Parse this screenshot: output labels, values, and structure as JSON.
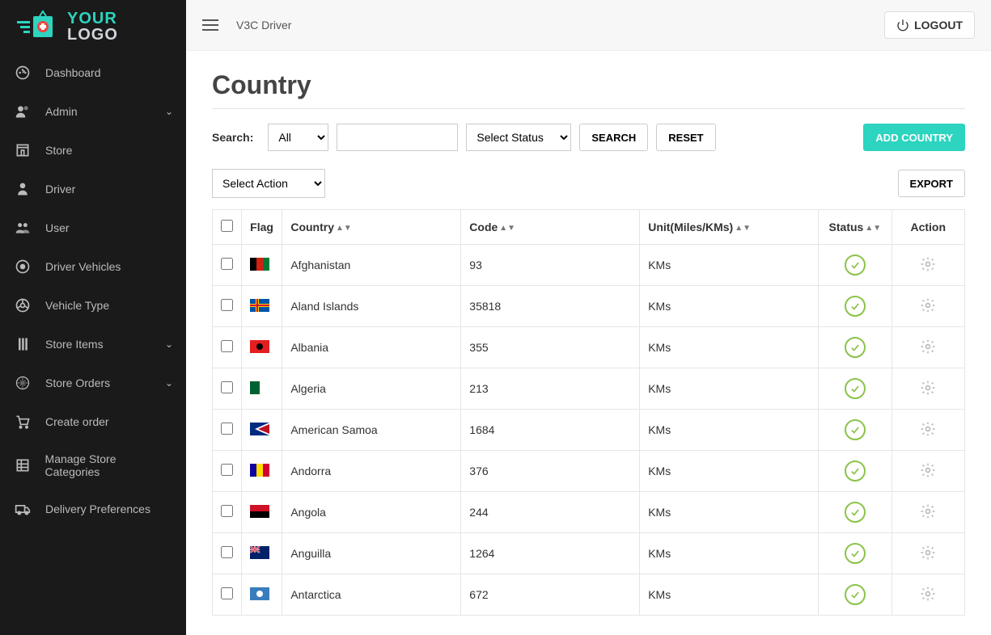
{
  "brand": {
    "top": "YOUR",
    "bottom": "LOGO"
  },
  "sidebar": {
    "items": [
      {
        "label": "Dashboard",
        "icon": "dashboard",
        "expandable": false
      },
      {
        "label": "Admin",
        "icon": "admin",
        "expandable": true
      },
      {
        "label": "Store",
        "icon": "store",
        "expandable": false
      },
      {
        "label": "Driver",
        "icon": "driver",
        "expandable": false
      },
      {
        "label": "User",
        "icon": "user",
        "expandable": false
      },
      {
        "label": "Driver Vehicles",
        "icon": "target",
        "expandable": false
      },
      {
        "label": "Vehicle Type",
        "icon": "wheel",
        "expandable": false
      },
      {
        "label": "Store Items",
        "icon": "items",
        "expandable": true
      },
      {
        "label": "Store Orders",
        "icon": "orders",
        "expandable": true
      },
      {
        "label": "Create order",
        "icon": "cart",
        "expandable": false
      },
      {
        "label": "Manage Store Categories",
        "icon": "categories",
        "expandable": false
      },
      {
        "label": "Delivery Preferences",
        "icon": "delivery",
        "expandable": false
      }
    ]
  },
  "topbar": {
    "breadcrumb": "V3C  Driver",
    "logout": "LOGOUT"
  },
  "page": {
    "title": "Country"
  },
  "search": {
    "label": "Search:",
    "filter_selected": "All",
    "status_selected": "Select Status",
    "search_btn": "SEARCH",
    "reset_btn": "RESET",
    "add_btn": "ADD COUNTRY"
  },
  "actions": {
    "select_action": "Select Action",
    "export": "EXPORT"
  },
  "table": {
    "headers": {
      "flag": "Flag",
      "country": "Country",
      "code": "Code",
      "unit": "Unit(Miles/KMs)",
      "status": "Status",
      "action": "Action"
    },
    "rows": [
      {
        "country": "Afghanistan",
        "code": "93",
        "unit": "KMs",
        "flag_colors": [
          "#000",
          "#d32011",
          "#007a36"
        ],
        "flag_style": "tricolor-v"
      },
      {
        "country": "Aland Islands",
        "code": "35818",
        "unit": "KMs",
        "flag_colors": [
          "#0053a5",
          "#ffce00",
          "#d21034"
        ],
        "flag_style": "nordic"
      },
      {
        "country": "Albania",
        "code": "355",
        "unit": "KMs",
        "flag_colors": [
          "#e41e20",
          "#000"
        ],
        "flag_style": "solid"
      },
      {
        "country": "Algeria",
        "code": "213",
        "unit": "KMs",
        "flag_colors": [
          "#006233",
          "#fff"
        ],
        "flag_style": "bicolor-v"
      },
      {
        "country": "American Samoa",
        "code": "1684",
        "unit": "KMs",
        "flag_colors": [
          "#002b7f",
          "#fff",
          "#bd1021"
        ],
        "flag_style": "diagonal"
      },
      {
        "country": "Andorra",
        "code": "376",
        "unit": "KMs",
        "flag_colors": [
          "#10069f",
          "#fedd00",
          "#d50032"
        ],
        "flag_style": "tricolor-v"
      },
      {
        "country": "Angola",
        "code": "244",
        "unit": "KMs",
        "flag_colors": [
          "#ce1126",
          "#000"
        ],
        "flag_style": "bicolor-h"
      },
      {
        "country": "Anguilla",
        "code": "1264",
        "unit": "KMs",
        "flag_colors": [
          "#012169",
          "#fff"
        ],
        "flag_style": "ensign"
      },
      {
        "country": "Antarctica",
        "code": "672",
        "unit": "KMs",
        "flag_colors": [
          "#3a7dbd",
          "#fff"
        ],
        "flag_style": "solid"
      }
    ]
  }
}
